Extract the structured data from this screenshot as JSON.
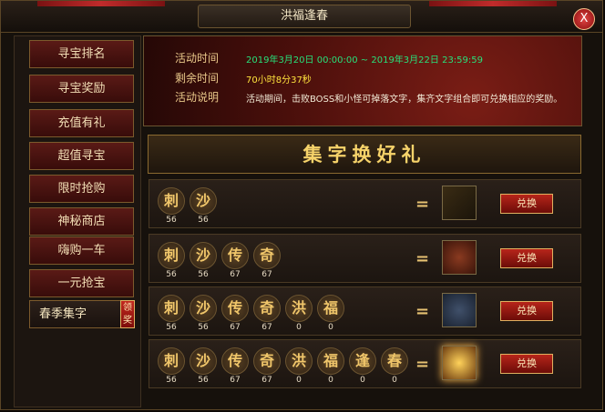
{
  "window": {
    "title": "洪福逢春",
    "close_label": "X"
  },
  "sidebar": {
    "items": [
      {
        "label": "寻宝排名"
      },
      {
        "label": "寻宝奖励"
      },
      {
        "label": "充值有礼"
      },
      {
        "label": "超值寻宝"
      },
      {
        "label": "限时抢购"
      },
      {
        "label": "神秘商店"
      },
      {
        "label": "嗨购一车"
      },
      {
        "label": "一元抢宝"
      },
      {
        "label": "春季集字",
        "badge": "领奖"
      }
    ]
  },
  "banner": {
    "time_label": "活动时间",
    "time_value": "2019年3月20日 00:00:00 ~ 2019年3月22日 23:59:59",
    "remain_label": "剩余时间",
    "remain_value": "70小时8分37秒",
    "desc_label": "活动说明",
    "desc_value": "活动期间，击败BOSS和小怪可掉落文字，集齐文字组合即可兑换相应的奖励。"
  },
  "section": {
    "title": "集字换好礼"
  },
  "rows": [
    {
      "chars": [
        {
          "c": "刺",
          "n": "56"
        },
        {
          "c": "沙",
          "n": "56"
        }
      ],
      "reward": "gold-bar-icon",
      "button": "兑换"
    },
    {
      "chars": [
        {
          "c": "刺",
          "n": "56"
        },
        {
          "c": "沙",
          "n": "56"
        },
        {
          "c": "传",
          "n": "67"
        },
        {
          "c": "奇",
          "n": "67"
        }
      ],
      "reward": "red-chest-icon",
      "button": "兑换"
    },
    {
      "chars": [
        {
          "c": "刺",
          "n": "56"
        },
        {
          "c": "沙",
          "n": "56"
        },
        {
          "c": "传",
          "n": "67"
        },
        {
          "c": "奇",
          "n": "67"
        },
        {
          "c": "洪",
          "n": "0"
        },
        {
          "c": "福",
          "n": "0"
        }
      ],
      "reward": "blue-chest-icon",
      "button": "兑换"
    },
    {
      "chars": [
        {
          "c": "刺",
          "n": "56"
        },
        {
          "c": "沙",
          "n": "56"
        },
        {
          "c": "传",
          "n": "67"
        },
        {
          "c": "奇",
          "n": "67"
        },
        {
          "c": "洪",
          "n": "0"
        },
        {
          "c": "福",
          "n": "0"
        },
        {
          "c": "逢",
          "n": "0"
        },
        {
          "c": "春",
          "n": "0"
        }
      ],
      "reward": "glowing-chest-icon",
      "button": "兑换"
    }
  ],
  "colors": {
    "accent": "#f6d36a",
    "banner_green": "#27e07a",
    "banner_yellow": "#ffe33d"
  }
}
